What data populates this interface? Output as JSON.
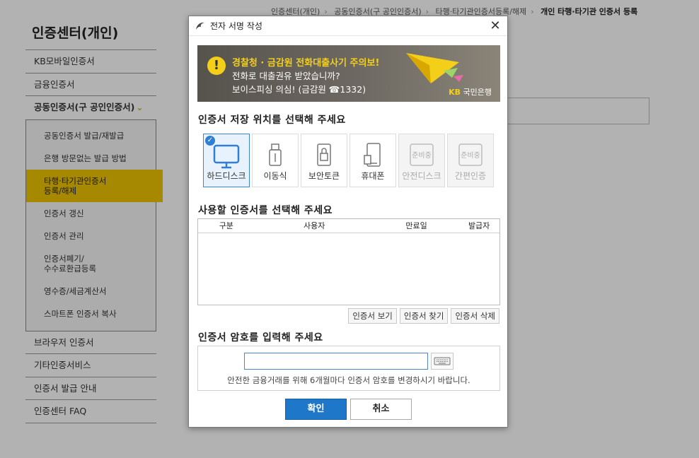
{
  "breadcrumb": [
    "인증센터(개인)",
    "공동인증서(구 공인인증서)",
    "타행·타기관인증서등록/해제",
    "개인 타행·타기관 인증서 등록"
  ],
  "sidebar": {
    "title": "인증센터(개인)",
    "items_top": [
      "KB모바일인증서",
      "금융인증서"
    ],
    "open_item": "공동인증서(구 공인인증서)",
    "subitems": [
      "공동인증서 발급/재발급",
      "은행 방문없는 발급 방법",
      "타행·타기관인증서\n등록/해제",
      "인증서 갱신",
      "인증서 관리",
      "인증서폐기/\n수수료환급등록",
      "영수증/세금계산서",
      "스마트폰 인증서 복사"
    ],
    "active_sub_index": 2,
    "items_bottom": [
      "브라우저 인증서",
      "기타인증서비스",
      "인증서 발급 안내",
      "인증센터 FAQ"
    ]
  },
  "dialog": {
    "title": "전자 서명 작성",
    "banner": {
      "line1": "경찰청 · 금감원 전화대출사기 주의보!",
      "line2": "전화로 대출권유 받았습니까?",
      "line3": "보이스피싱 의심! (금감원 ☎1332)",
      "logo_kb": "KB",
      "logo_text": "국민은행"
    },
    "storage_title": "인증서 저장 위치를 선택해 주세요",
    "storage": [
      {
        "label": "하드디스크",
        "icon": "monitor-icon",
        "selected": true,
        "disabled": false
      },
      {
        "label": "이동식",
        "icon": "usb-icon",
        "selected": false,
        "disabled": false
      },
      {
        "label": "보안토큰",
        "icon": "token-icon",
        "selected": false,
        "disabled": false
      },
      {
        "label": "휴대폰",
        "icon": "phone-icon",
        "selected": false,
        "disabled": false
      },
      {
        "label": "안전디스크",
        "icon": "preparing-icon",
        "badge": "준비중",
        "selected": false,
        "disabled": true
      },
      {
        "label": "간편인증",
        "icon": "preparing-icon",
        "badge": "준비중",
        "selected": false,
        "disabled": true
      }
    ],
    "cert_title": "사용할 인증서를 선택해 주세요",
    "table_headers": [
      "구분",
      "사용자",
      "만료일",
      "발급자"
    ],
    "cert_buttons": [
      "인증서 보기",
      "인증서 찾기",
      "인증서 삭제"
    ],
    "pw_title": "인증서 암호를 입력해 주세요",
    "pw_value": "",
    "pw_note": "안전한 금융거래를 위해 6개월마다 인증서 암호를 변경하시기 바랍니다.",
    "ok_label": "확인",
    "cancel_label": "취소"
  },
  "colors": {
    "accent_blue": "#1f77c9",
    "banner_yellow": "#f4cf1a",
    "sidebar_active": "#f0c400"
  }
}
